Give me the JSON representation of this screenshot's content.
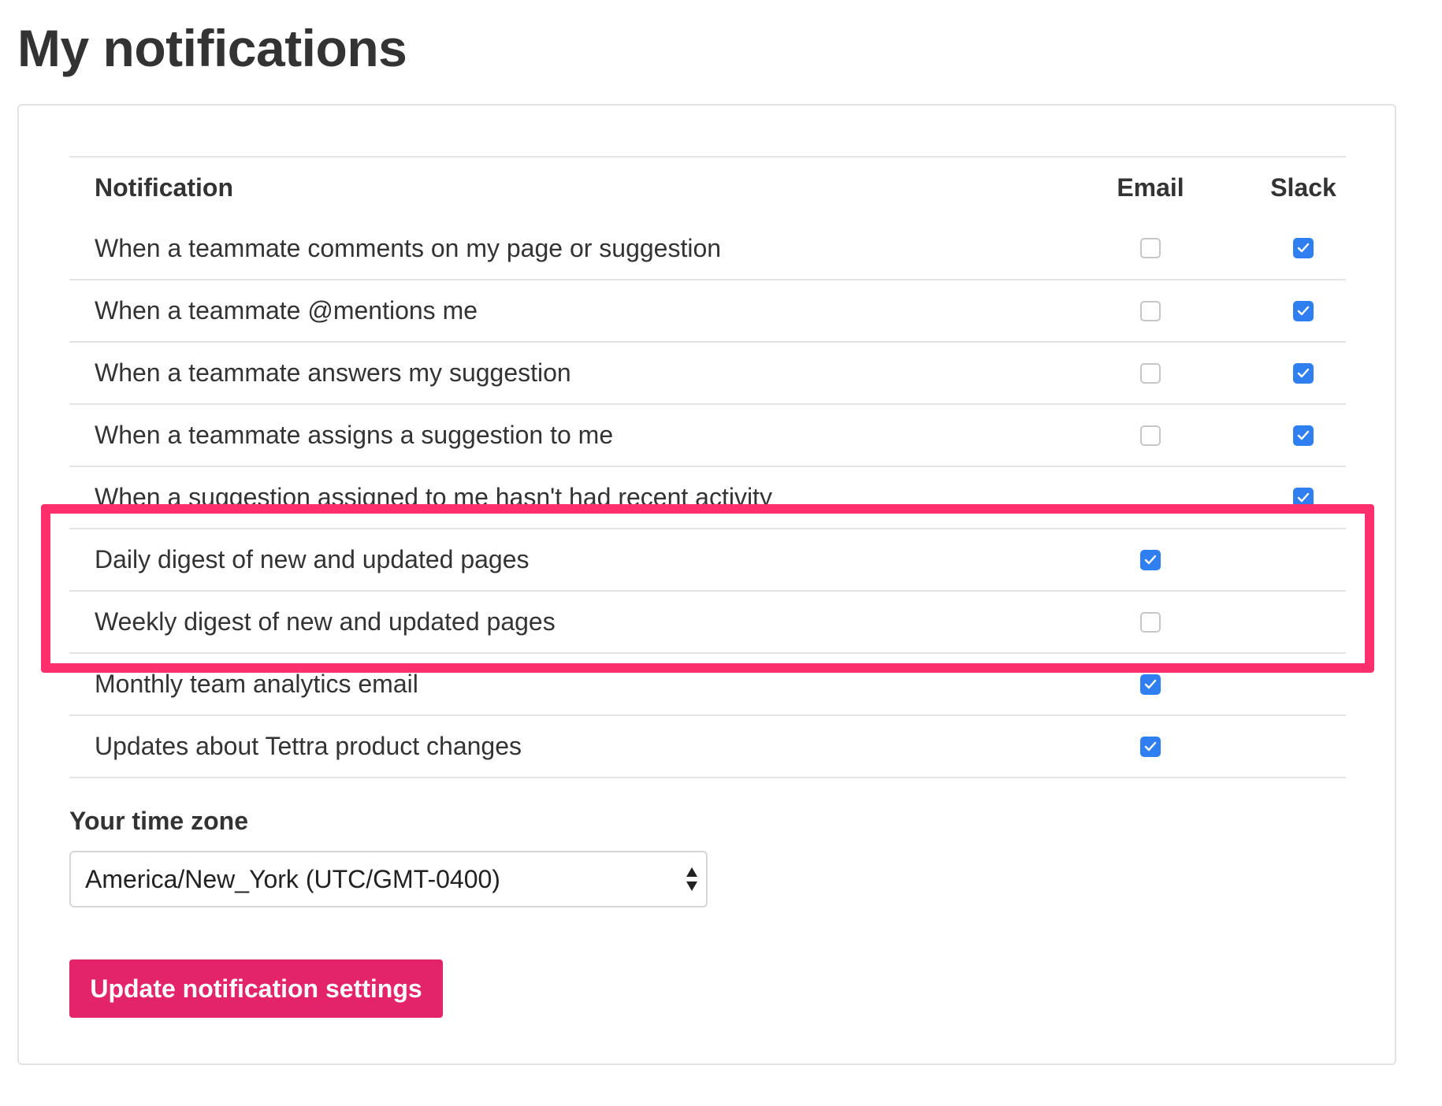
{
  "page": {
    "title": "My notifications"
  },
  "table": {
    "headers": {
      "notification": "Notification",
      "email": "Email",
      "slack": "Slack"
    },
    "rows": [
      {
        "label": "When a teammate comments on my page or suggestion",
        "email": false,
        "slack": true
      },
      {
        "label": "When a teammate @mentions me",
        "email": false,
        "slack": true
      },
      {
        "label": "When a teammate answers my suggestion",
        "email": false,
        "slack": true
      },
      {
        "label": "When a teammate assigns a suggestion to me",
        "email": false,
        "slack": true
      },
      {
        "label": "When a suggestion assigned to me hasn't had recent activity",
        "email": null,
        "slack": true
      },
      {
        "label": "Daily digest of new and updated pages",
        "email": true,
        "slack": null
      },
      {
        "label": "Weekly digest of new and updated pages",
        "email": false,
        "slack": null
      },
      {
        "label": "Monthly team analytics email",
        "email": true,
        "slack": null
      },
      {
        "label": "Updates about Tettra product changes",
        "email": true,
        "slack": null
      }
    ]
  },
  "timezone": {
    "label": "Your time zone",
    "selected": "America/New_York (UTC/GMT-0400)"
  },
  "actions": {
    "update_label": "Update notification settings"
  },
  "colors": {
    "checkbox_checked": "#2f7ff0",
    "button_primary": "#e3246a",
    "highlight": "#ff2f6d"
  }
}
